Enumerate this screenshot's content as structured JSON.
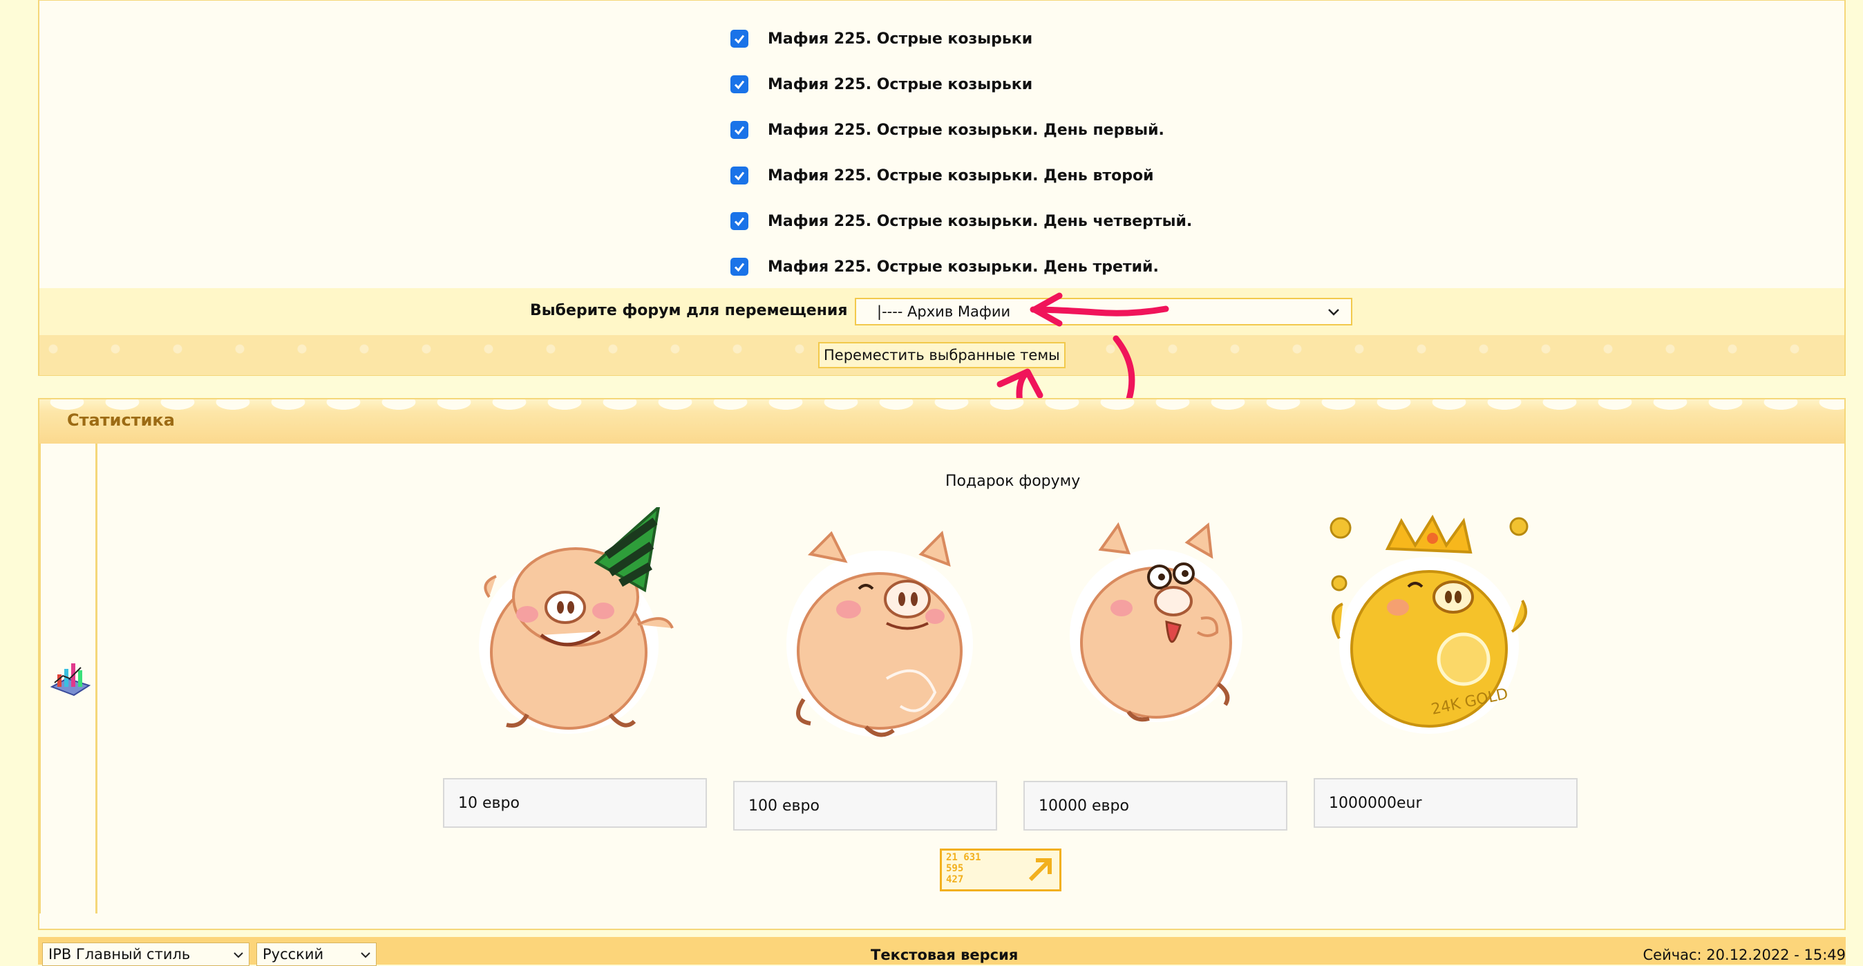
{
  "topics": [
    {
      "label": "Мафия 225. Острые козырьки",
      "checked": true
    },
    {
      "label": "Мафия 225. Острые козырьки",
      "checked": true
    },
    {
      "label": "Мафия 225. Острые козырьки. День первый.",
      "checked": true
    },
    {
      "label": "Мафия 225. Острые козырьки. День второй",
      "checked": true
    },
    {
      "label": "Мафия 225. Острые козырьки. День четвертый.",
      "checked": true
    },
    {
      "label": "Мафия 225. Острые козырьки. День третий.",
      "checked": true
    }
  ],
  "move": {
    "label": "Выберите форум для перемещения",
    "selected_forum": "|---- Архив Мафии",
    "button_label": "Переместить выбранные темы"
  },
  "stats": {
    "title": "Статистика",
    "gift_title": "Подарок форуму",
    "prices": [
      "10 евро",
      "100 евро",
      "10000 евро",
      "1000000eur"
    ],
    "counter_lines": [
      "21 631",
      "595",
      "427"
    ]
  },
  "footer": {
    "skin_select": "IPB Главный стиль",
    "language_select": "Русский",
    "text_version": "Текстовая версия",
    "now": "Сейчас: 20.12.2022 - 15:49"
  },
  "colors": {
    "page_bg": "#fefcd7",
    "border": "#f5d77a",
    "checkbox": "#1a73e8",
    "annotation": "#f0145a",
    "stats_title": "#9c6b14"
  }
}
